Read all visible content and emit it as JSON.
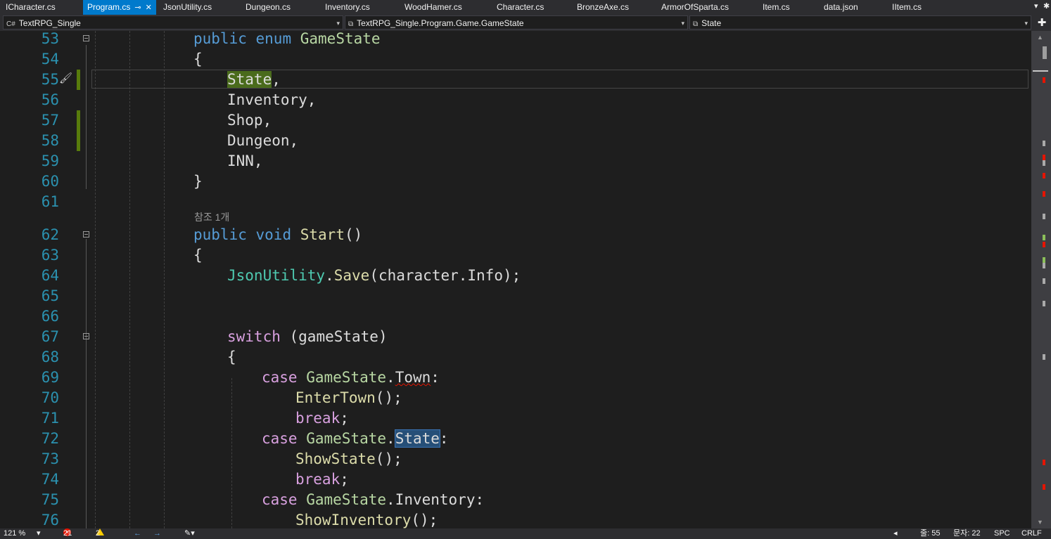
{
  "tabs": [
    {
      "label": "ICharacter.cs"
    },
    {
      "label": "Program.cs"
    },
    {
      "label": "JsonUtility.cs"
    },
    {
      "label": "Dungeon.cs"
    },
    {
      "label": "Inventory.cs"
    },
    {
      "label": "WoodHamer.cs"
    },
    {
      "label": "Character.cs"
    },
    {
      "label": "BronzeAxe.cs"
    },
    {
      "label": "ArmorOfSparta.cs"
    },
    {
      "label": "Item.cs"
    },
    {
      "label": "data.json"
    },
    {
      "label": "IItem.cs"
    }
  ],
  "nav": {
    "project": "TextRPG_Single",
    "type": "TextRPG_Single.Program.Game.GameState",
    "member": "State"
  },
  "reference_count": "참조 1개",
  "lines": [
    {
      "n": "53"
    },
    {
      "n": "54"
    },
    {
      "n": "55"
    },
    {
      "n": "56"
    },
    {
      "n": "57"
    },
    {
      "n": "58"
    },
    {
      "n": "59"
    },
    {
      "n": "60"
    },
    {
      "n": "61"
    },
    {
      "n": "62"
    },
    {
      "n": "63"
    },
    {
      "n": "64"
    },
    {
      "n": "65"
    },
    {
      "n": "66"
    },
    {
      "n": "67"
    },
    {
      "n": "68"
    },
    {
      "n": "69"
    },
    {
      "n": "70"
    },
    {
      "n": "71"
    },
    {
      "n": "72"
    },
    {
      "n": "73"
    },
    {
      "n": "74"
    },
    {
      "n": "75"
    },
    {
      "n": "76"
    }
  ],
  "code": {
    "l53": [
      "public",
      "enum",
      "GameState"
    ],
    "l54": "{",
    "l55": [
      "State",
      ","
    ],
    "l56": "Inventory,",
    "l57": "Shop,",
    "l58": "Dungeon,",
    "l59": "INN,",
    "l60": "}",
    "l62": [
      "public",
      "void",
      "Start",
      "()"
    ],
    "l63": "{",
    "l64": [
      "JsonUtility",
      ".",
      "Save",
      "(character.Info);"
    ],
    "l67": [
      "switch",
      "(gameState)"
    ],
    "l68": "{",
    "l69": [
      "case",
      "GameState",
      ".",
      "Town",
      ":"
    ],
    "l70": [
      "EnterTown",
      "();"
    ],
    "l71": [
      "break",
      ";"
    ],
    "l72": [
      "case",
      "GameState",
      ".",
      "State",
      ":"
    ],
    "l73": [
      "ShowState",
      "();"
    ],
    "l74": [
      "break",
      ";"
    ],
    "l75": [
      "case",
      "GameState",
      ".Inventory:"
    ],
    "l76": [
      "ShowInventory",
      "();"
    ]
  },
  "status": {
    "zoom": "121 %",
    "errors": "21",
    "warnings": "2",
    "line": "줄: 55",
    "col": "문자: 22",
    "spc": "SPC",
    "eol": "CRLF"
  },
  "colors": {
    "keyword": "#569cd6",
    "control": "#d8a0df",
    "type": "#4ec9b0",
    "enum_type": "#b8d7a3",
    "method": "#dcdcaa",
    "line_number": "#2b91af",
    "active_tab": "#007acc"
  }
}
